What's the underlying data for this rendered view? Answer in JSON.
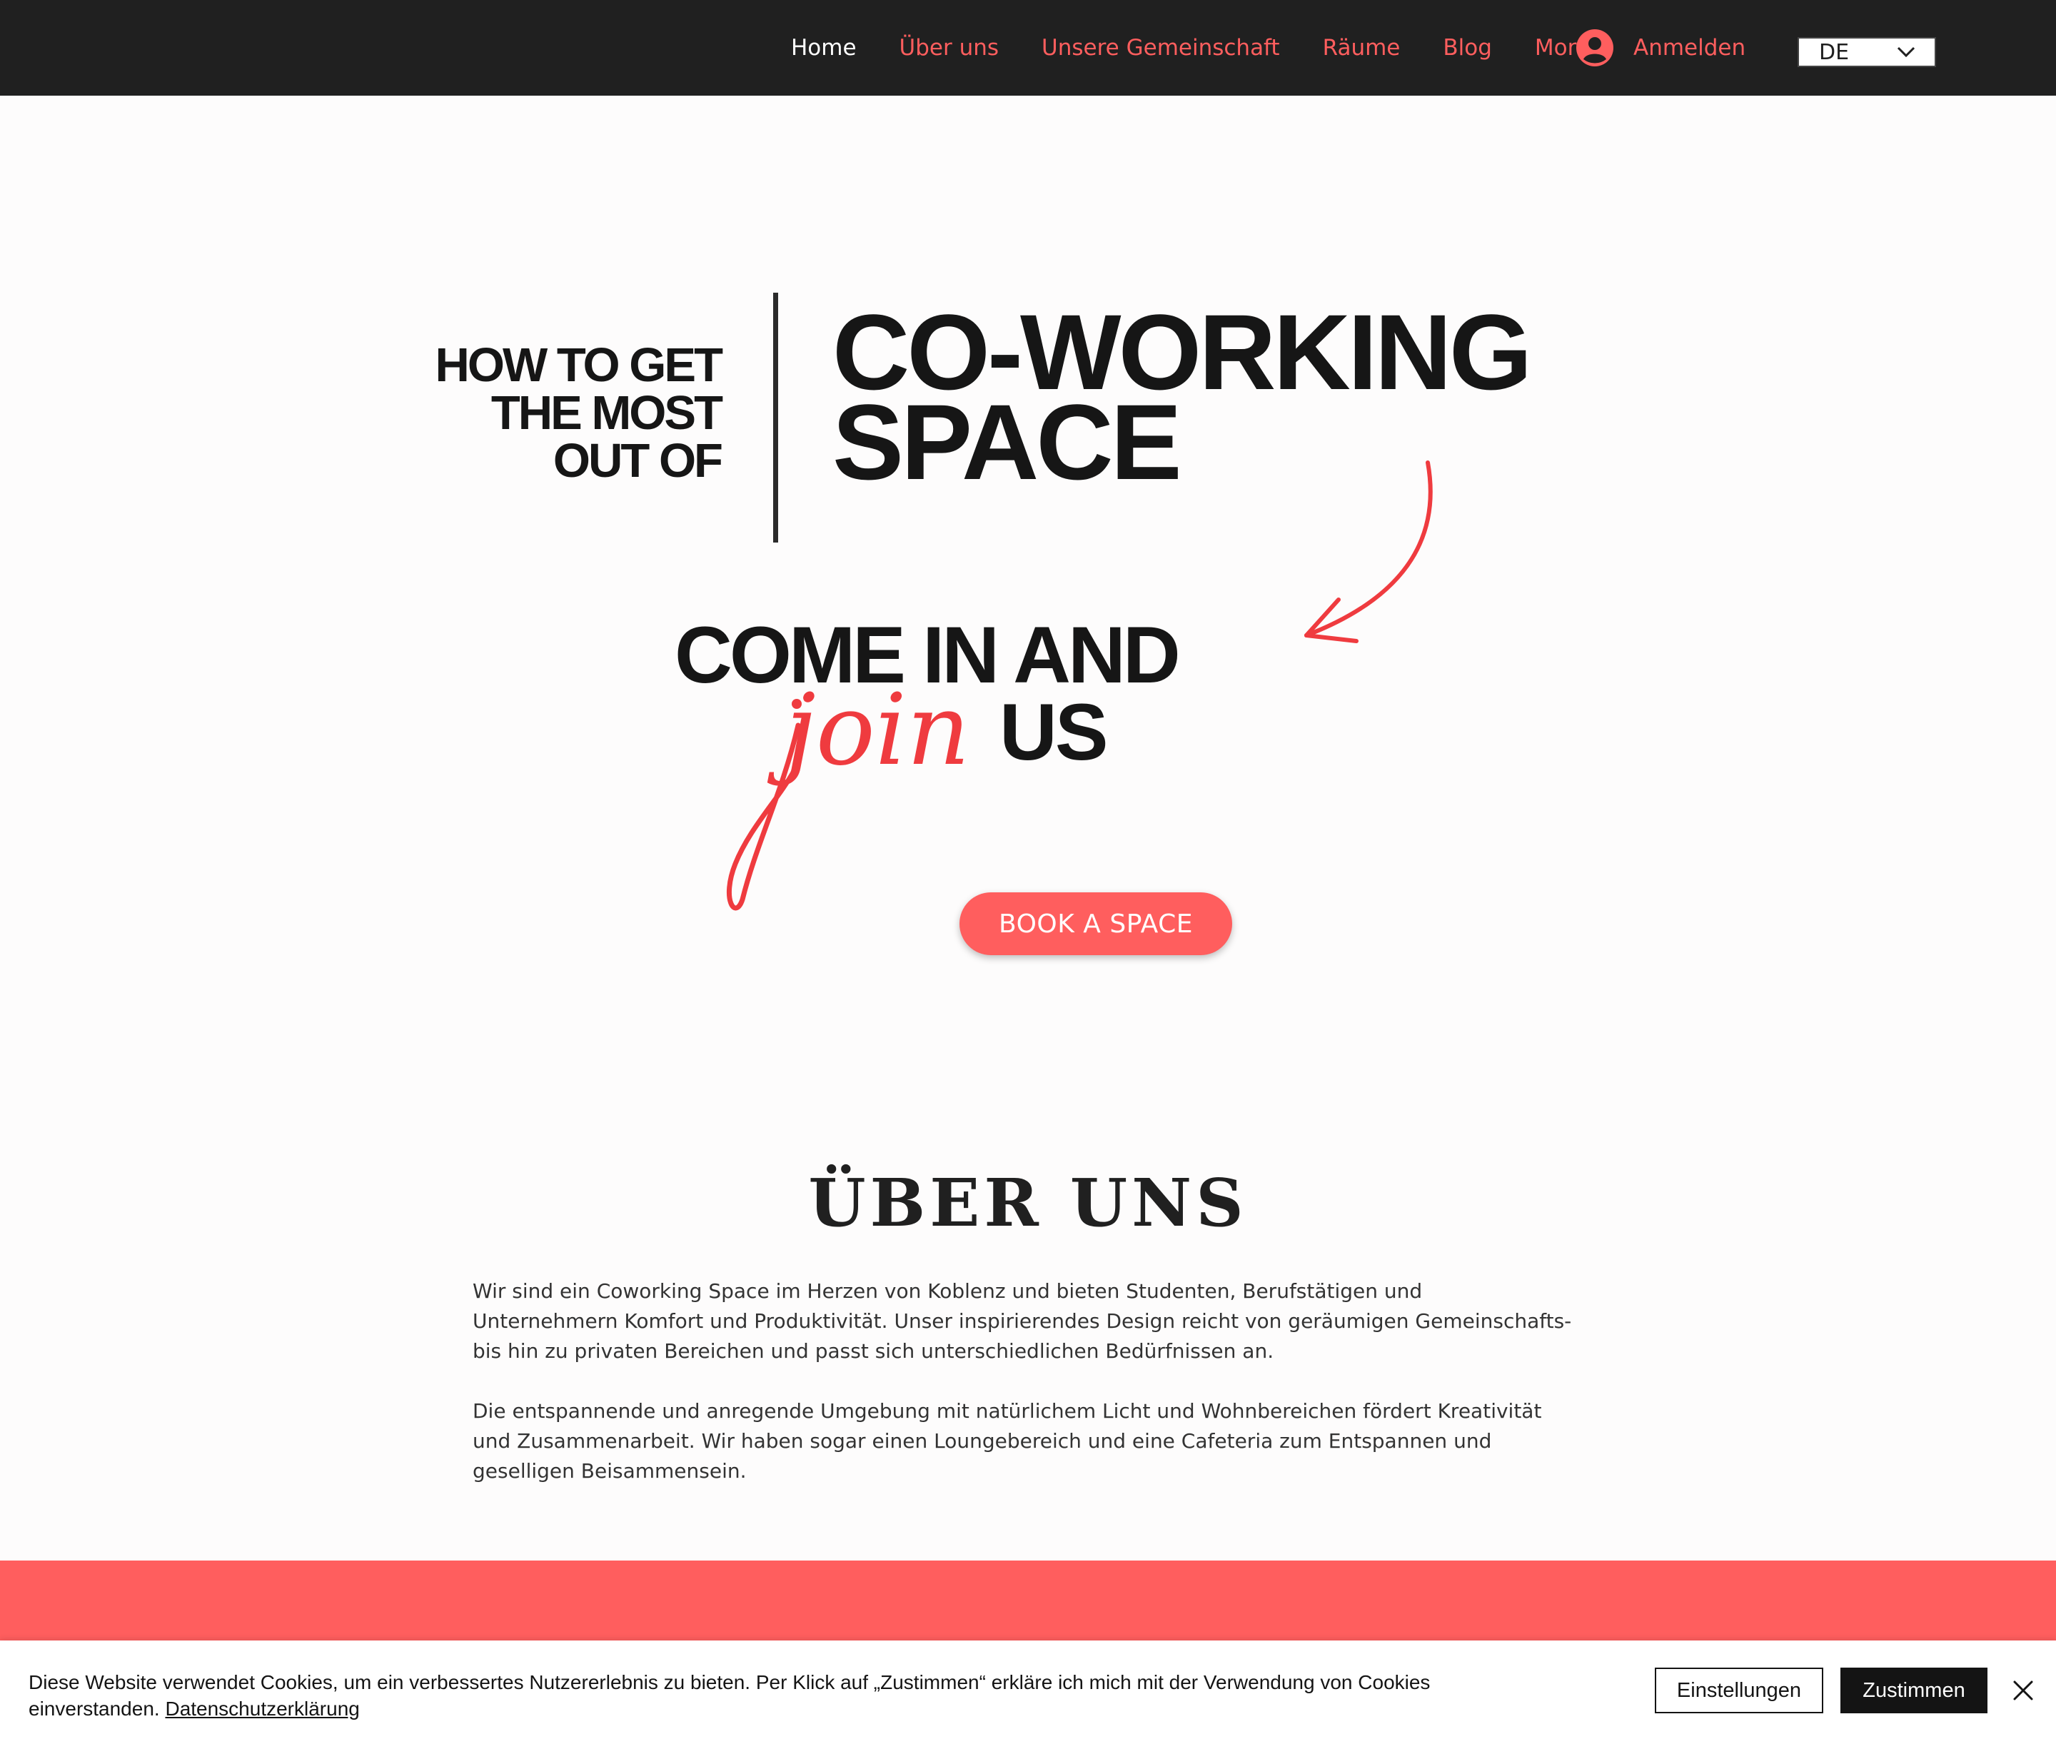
{
  "nav": {
    "items": [
      {
        "label": "Home",
        "active": true
      },
      {
        "label": "Über uns",
        "active": false
      },
      {
        "label": "Unsere Gemeinschaft",
        "active": false
      },
      {
        "label": "Räume",
        "active": false
      },
      {
        "label": "Blog",
        "active": false
      },
      {
        "label": "More",
        "active": false
      }
    ],
    "login_label": "Anmelden",
    "login_icon": "user-avatar-icon",
    "language": {
      "selected": "DE",
      "icon": "chevron-down-icon"
    }
  },
  "hero": {
    "left_lines": [
      "HOW TO GET",
      "THE MOST",
      "OUT OF"
    ],
    "right_lines": [
      "CO-WORKING",
      "SPACE"
    ],
    "come_in": "COME IN AND",
    "join": "join",
    "us": "US",
    "cta_label": "BOOK A SPACE"
  },
  "about": {
    "title": "ÜBER UNS",
    "paragraphs": [
      "Wir sind ein Coworking Space im Herzen von Koblenz und bieten Studenten, Berufstätigen und Unternehmern Komfort und Produktivität. Unser inspirierendes Design reicht von geräumigen Gemeinschafts- bis hin zu privaten Bereichen und passt sich unterschiedlichen Bedürfnissen an.",
      "Die entspannende und anregende Umgebung mit natürlichem Licht und Wohnbereichen fördert Kreativität und Zusammenarbeit. Wir haben sogar einen Loungebereich und eine Cafeteria zum Entspannen und geselligen Beisammensein."
    ]
  },
  "cookie": {
    "text": "Diese Website verwendet Cookies, um ein verbessertes Nutzererlebnis zu bieten. Per Klick auf „Zustimmen“ erkläre ich mich mit der Verwendung von Cookies einverstanden.",
    "link_label": "Datenschutzerklärung",
    "settings_label": "Einstellungen",
    "accept_label": "Zustimmen",
    "close_icon": "close-icon"
  },
  "colors": {
    "header_bg": "#202020",
    "accent": "#ff5e5e",
    "script_red": "#ef3b3f",
    "text_dark": "#161616"
  }
}
